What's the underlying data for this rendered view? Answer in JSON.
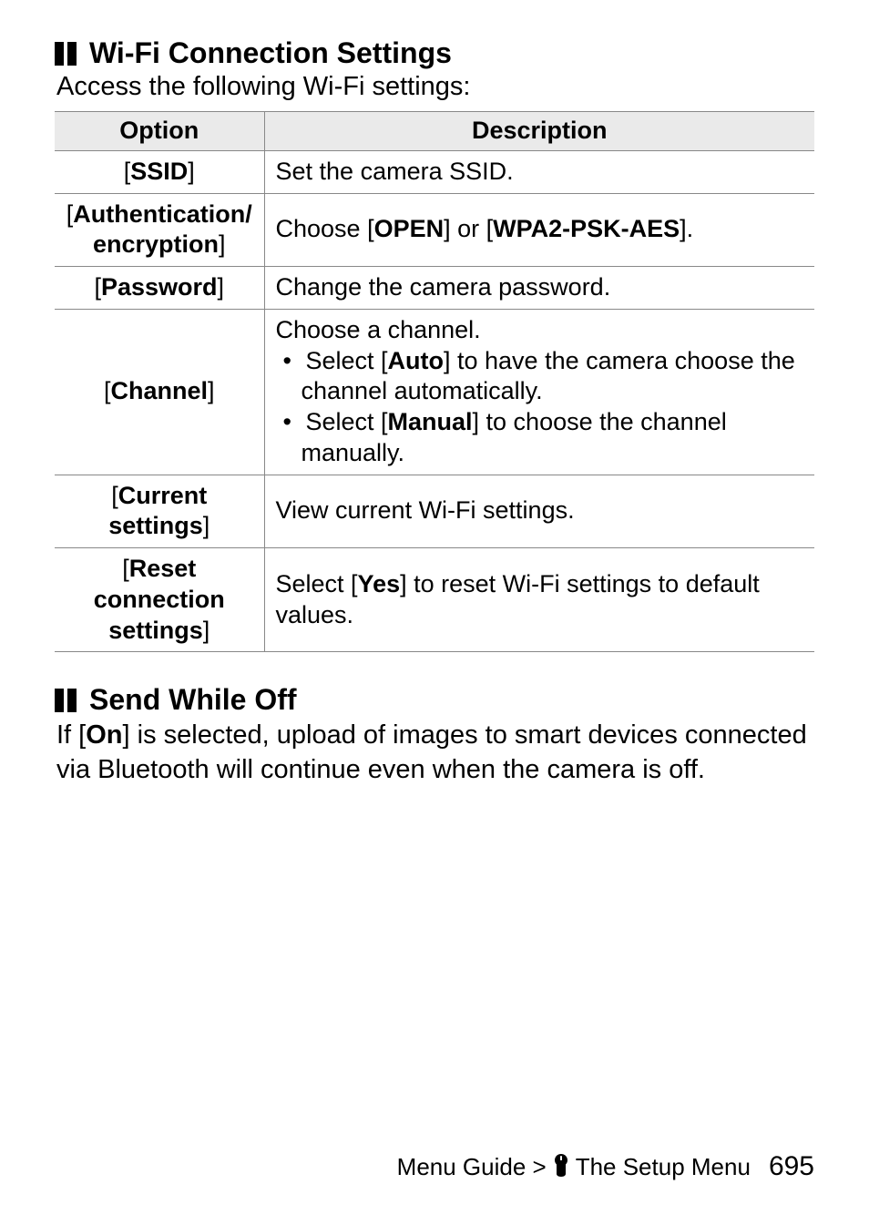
{
  "section1": {
    "title": "Wi-Fi Connection Settings",
    "subtitle": "Access the following Wi-Fi settings:",
    "table": {
      "headers": {
        "option": "Option",
        "description": "Description"
      },
      "rows": [
        {
          "option_prefix": "[",
          "option_core": "SSID",
          "option_suffix": "]",
          "desc_plain": "Set the camera SSID."
        },
        {
          "option_prefix": "[",
          "option_core": "Authentication/\nencryption",
          "option_suffix": "]",
          "desc_before": "Choose [",
          "desc_b1": "OPEN",
          "desc_mid": "] or [",
          "desc_b2": "WPA2-PSK-AES",
          "desc_after": "]."
        },
        {
          "option_prefix": "[",
          "option_core": "Password",
          "option_suffix": "]",
          "desc_plain": "Change the camera password."
        },
        {
          "option_prefix": "[",
          "option_core": "Channel",
          "option_suffix": "]",
          "desc_lead": "Choose a channel.",
          "bullets": [
            {
              "pre": "Select [",
              "b": "Auto",
              "post": "] to have the camera choose the channel automatically."
            },
            {
              "pre": "Select [",
              "b": "Manual",
              "post": "] to choose the channel manually."
            }
          ]
        },
        {
          "option_prefix": "[",
          "option_core": "Current settings",
          "option_suffix": "]",
          "desc_plain": "View current Wi-Fi settings."
        },
        {
          "option_prefix": "[",
          "option_core": "Reset connection settings",
          "option_suffix": "]",
          "desc_before": "Select [",
          "desc_b1": "Yes",
          "desc_mid": "",
          "desc_b2": "",
          "desc_after": "] to reset Wi-Fi settings to default values."
        }
      ]
    }
  },
  "section2": {
    "title": "Send While Off",
    "body_before": "If [",
    "body_bold": "On",
    "body_after": "] is selected, upload of images to smart devices connected via Bluetooth will continue even when the camera is off."
  },
  "footer": {
    "trail_before": "Menu Guide > ",
    "trail_after": " The Setup Menu",
    "page": "695"
  }
}
